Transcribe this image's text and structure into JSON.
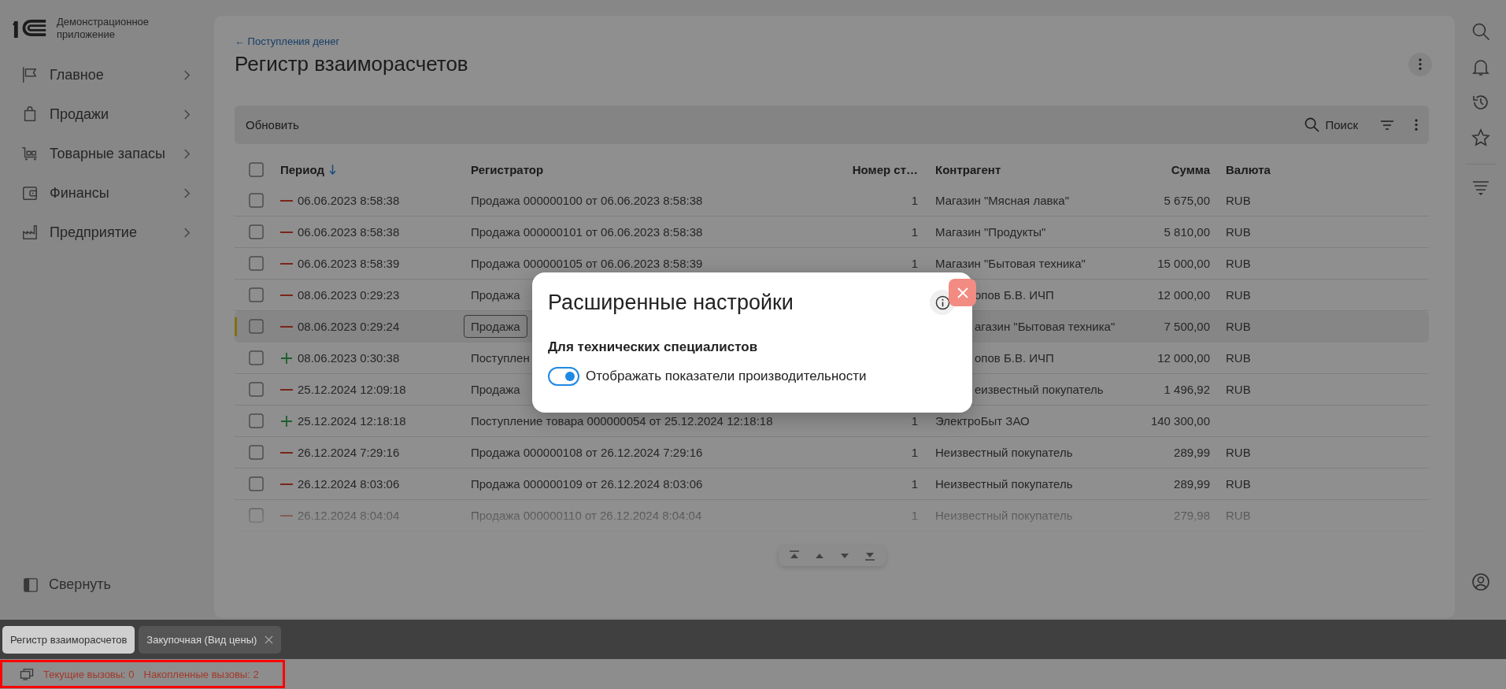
{
  "sidebar": {
    "app_name": "Демонстрационное приложение",
    "items": [
      {
        "label": "Главное"
      },
      {
        "label": "Продажи"
      },
      {
        "label": "Товарные запасы"
      },
      {
        "label": "Финансы"
      },
      {
        "label": "Предприятие"
      }
    ],
    "collapse": "Свернуть"
  },
  "page": {
    "back_link": "← Поступления денег",
    "title": "Регистр взаиморасчетов"
  },
  "toolbar": {
    "refresh": "Обновить",
    "search": "Поиск"
  },
  "table": {
    "select_all_checked": false,
    "columns": [
      {
        "label": "Период",
        "sorted": true
      },
      {
        "label": "Регистратор"
      },
      {
        "label": "Номер ст…"
      },
      {
        "label": "Контрагент"
      },
      {
        "label": "Сумма"
      },
      {
        "label": "Валюта"
      }
    ],
    "rows": [
      {
        "kind": "expense",
        "period": "06.06.2023 8:58:38",
        "registrator": "Продажа 000000100 от 06.06.2023 8:58:38",
        "number": "1",
        "counterparty": "Магазин \"Мясная лавка\"",
        "amount": "5 675,00",
        "currency": "RUB",
        "checked": false,
        "selected": false
      },
      {
        "kind": "expense",
        "period": "06.06.2023 8:58:38",
        "registrator": "Продажа 000000101 от 06.06.2023 8:58:38",
        "number": "1",
        "counterparty": "Магазин \"Продукты\"",
        "amount": "5 810,00",
        "currency": "RUB",
        "checked": false,
        "selected": false
      },
      {
        "kind": "expense",
        "period": "06.06.2023 8:58:39",
        "registrator": "Продажа 000000105 от 06.06.2023 8:58:39",
        "number": "1",
        "counterparty": "Магазин \"Бытовая техника\"",
        "amount": "15 000,00",
        "currency": "RUB",
        "checked": false,
        "selected": false
      },
      {
        "kind": "expense",
        "period": "08.06.2023 0:29:23",
        "registrator": "Продажа",
        "counterparty": "опов Б.В. ИЧП",
        "amount": "12 000,00",
        "currency": "RUB",
        "checked": false,
        "selected": false
      },
      {
        "kind": "expense",
        "period": "08.06.2023 0:29:24",
        "registrator": "Продажа",
        "counterparty": "агазин \"Бытовая техника\"",
        "amount": "7 500,00",
        "currency": "RUB",
        "checked": false,
        "selected": true
      },
      {
        "kind": "receipt",
        "period": "08.06.2023 0:30:38",
        "registrator": "Поступлен",
        "counterparty": "опов Б.В. ИЧП",
        "amount": "12 000,00",
        "currency": "RUB",
        "checked": false,
        "selected": false
      },
      {
        "kind": "expense",
        "period": "25.12.2024 12:09:18",
        "registrator": "Продажа",
        "counterparty": "еизвестный покупатель",
        "amount": "1 496,92",
        "currency": "RUB",
        "checked": false,
        "selected": false
      },
      {
        "kind": "receipt",
        "period": "25.12.2024 12:18:18",
        "registrator": "Поступление товара 000000054 от 25.12.2024 12:18:18",
        "number": "1",
        "counterparty": "ЭлектроБыт ЗАО",
        "amount": "140 300,00",
        "checked": false,
        "selected": false
      },
      {
        "kind": "expense",
        "period": "26.12.2024 7:29:16",
        "registrator": "Продажа 000000108 от 26.12.2024 7:29:16",
        "number": "1",
        "counterparty": "Неизвестный покупатель",
        "amount": "289,99",
        "currency": "RUB",
        "checked": false,
        "selected": false
      },
      {
        "kind": "expense",
        "period": "26.12.2024 8:03:06",
        "registrator": "Продажа 000000109 от 26.12.2024 8:03:06",
        "number": "1",
        "counterparty": "Неизвестный покупатель",
        "amount": "289,99",
        "currency": "RUB",
        "checked": false,
        "selected": false
      },
      {
        "kind": "expense",
        "period": "26.12.2024 8:04:04",
        "registrator": "Продажа 000000110 от 26.12.2024 8:04:04",
        "number": "1",
        "counterparty": "Неизвестный покупатель",
        "amount": "279,98",
        "currency": "RUB",
        "checked": false,
        "selected": false
      }
    ]
  },
  "dialog": {
    "title": "Расширенные настройки",
    "section": "Для технических специалистов",
    "toggle": {
      "label": "Отображать показатели производительности",
      "on": true
    }
  },
  "tabs": [
    {
      "label": "Регистр взаиморасчетов",
      "selected": true,
      "closable": false
    },
    {
      "label": "Закупочная (Вид цены)",
      "selected": false,
      "closable": true
    }
  ],
  "status_bar": {
    "current_calls": "Текущие вызовы: 0",
    "accumulated_calls": "Накопленные вызовы: 2"
  }
}
